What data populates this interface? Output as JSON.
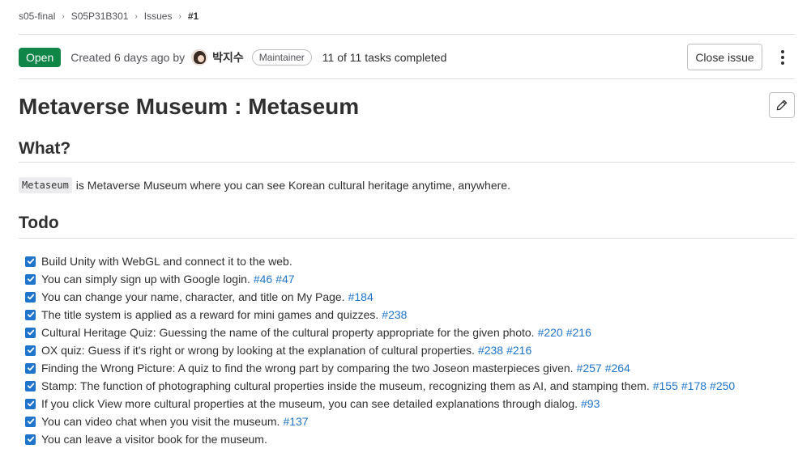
{
  "breadcrumb": {
    "items": [
      "s05-final",
      "S05P31B301",
      "Issues"
    ],
    "current": "#1"
  },
  "issue": {
    "status": "Open",
    "created_text": "Created 6 days ago by",
    "author": "박지수",
    "role": "Maintainer",
    "tasks_text": "11 of 11 tasks completed",
    "close_label": "Close issue",
    "title": "Metaverse Museum : Metaseum"
  },
  "sections": {
    "what_heading": "What?",
    "what_code": "Metaseum",
    "what_text": "is Metaverse Museum where you can see Korean cultural heritage anytime, anywhere.",
    "todo_heading": "Todo"
  },
  "todo_items": [
    {
      "text": "Build Unity with WebGL and connect it to the web.",
      "links": []
    },
    {
      "text": "You can simply sign up with Google login.",
      "links": [
        "#46",
        "#47"
      ]
    },
    {
      "text": "You can change your name, character, and title on My Page.",
      "links": [
        "#184"
      ]
    },
    {
      "text": "The title system is applied as a reward for mini games and quizzes.",
      "links": [
        "#238"
      ]
    },
    {
      "text": "Cultural Heritage Quiz: Guessing the name of the cultural property appropriate for the given photo.",
      "links": [
        "#220",
        "#216"
      ]
    },
    {
      "text": "OX quiz: Guess if it's right or wrong by looking at the explanation of cultural properties.",
      "links": [
        "#238",
        "#216"
      ]
    },
    {
      "text": "Finding the Wrong Picture: A quiz to find the wrong part by comparing the two Joseon masterpieces given.",
      "links": [
        "#257",
        "#264"
      ]
    },
    {
      "text": "Stamp: The function of photographing cultural properties inside the museum, recognizing them as AI, and stamping them.",
      "links": [
        "#155",
        "#178",
        "#250"
      ]
    },
    {
      "text": "If you click View more cultural properties at the museum, you can see detailed explanations through dialog.",
      "links": [
        "#93"
      ]
    },
    {
      "text": "You can video chat when you visit the museum.",
      "links": [
        "#137"
      ]
    },
    {
      "text": "You can leave a visitor book for the museum.",
      "links": []
    }
  ],
  "icons": {
    "breadcrumb_separator": "chevron-right-icon",
    "more": "kebab-menu-icon",
    "edit": "pencil-icon",
    "checkbox": "check-icon"
  },
  "colors": {
    "open_badge": "#108548",
    "link": "#1f75cb",
    "checkbox": "#1f75cb"
  }
}
